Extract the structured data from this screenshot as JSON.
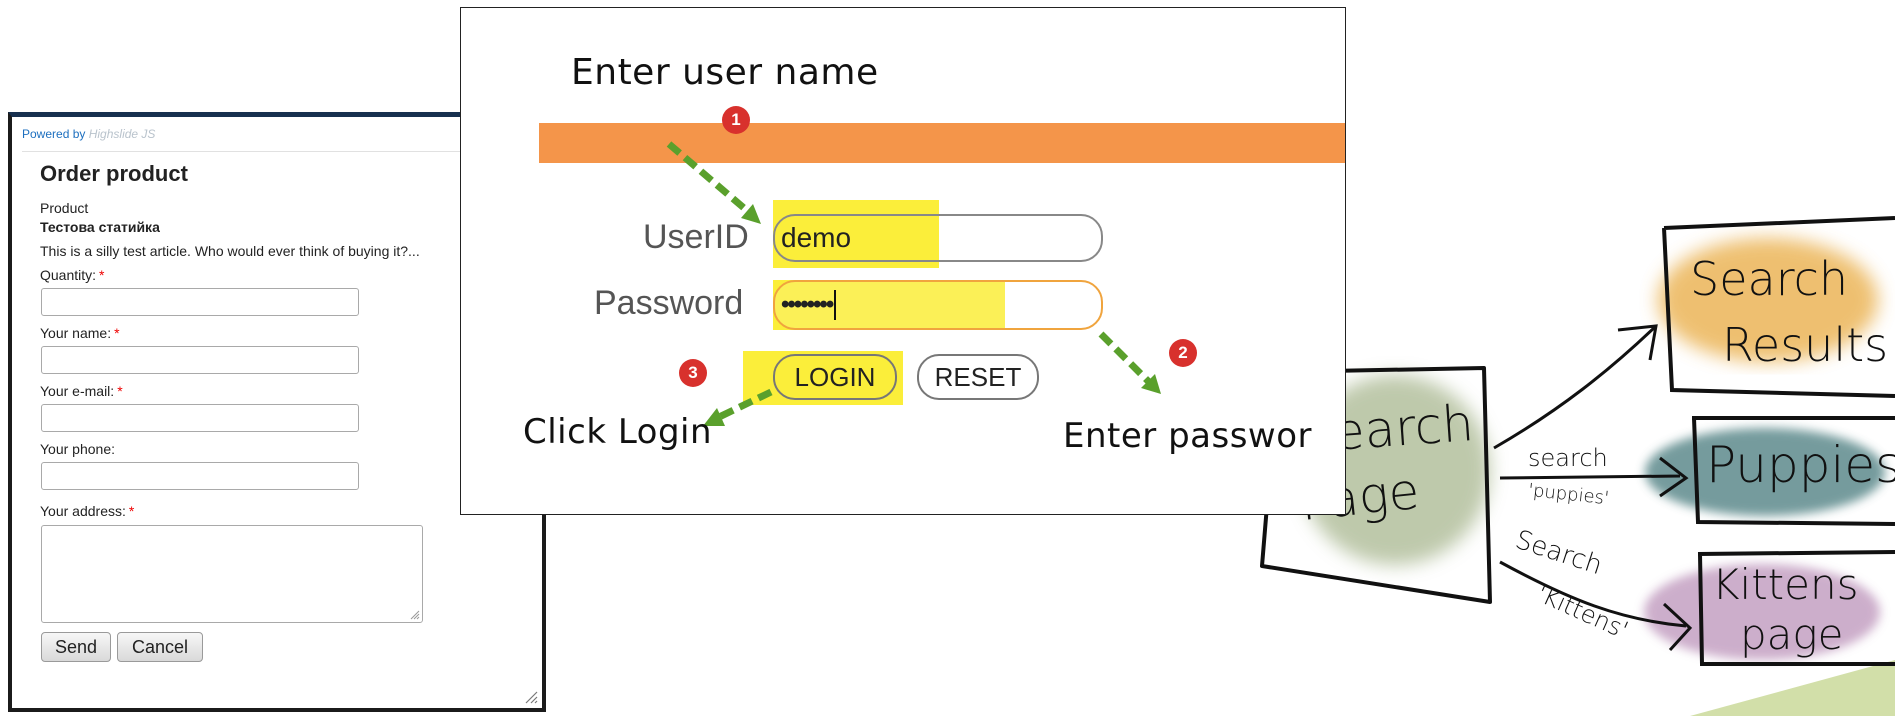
{
  "order_form": {
    "powered_by": "Powered by",
    "powered_by_brand": "Highslide JS",
    "title": "Order product",
    "product_label": "Product",
    "product_name": "Тестова статийка",
    "product_description": "This is a silly test article. Who would ever think of buying it?...",
    "fields": {
      "quantity": {
        "label": "Quantity:",
        "required": "*"
      },
      "name": {
        "label": "Your name:",
        "required": "*"
      },
      "email": {
        "label": "Your e-mail:",
        "required": "*"
      },
      "phone": {
        "label": "Your phone:"
      },
      "address": {
        "label": "Your address:",
        "required": "*"
      }
    },
    "send_label": "Send",
    "cancel_label": "Cancel"
  },
  "login_tutorial": {
    "step1_caption": "Enter user name",
    "step2_caption": "Enter passwor",
    "step3_caption": "Click Login",
    "badges": [
      "1",
      "2",
      "3"
    ],
    "userid_label": "UserID",
    "userid_value": "demo",
    "password_label": "Password",
    "password_value": "••••••••",
    "login_label": "LOGIN",
    "reset_label": "RESET",
    "colors": {
      "bar": "#f4954a",
      "highlight": "#fbee3a",
      "badge": "#d8312d",
      "arrow": "#5aa02c"
    }
  },
  "sitemap_sketch": {
    "search_page": [
      "Search",
      "Page"
    ],
    "search_results": [
      "Search",
      "Results"
    ],
    "puppies": "Puppies",
    "kittens_page": [
      "Kittens",
      "page"
    ],
    "link_puppies": [
      "search",
      "'puppies'"
    ],
    "link_kittens": [
      "Search",
      "'Kittens'"
    ]
  }
}
